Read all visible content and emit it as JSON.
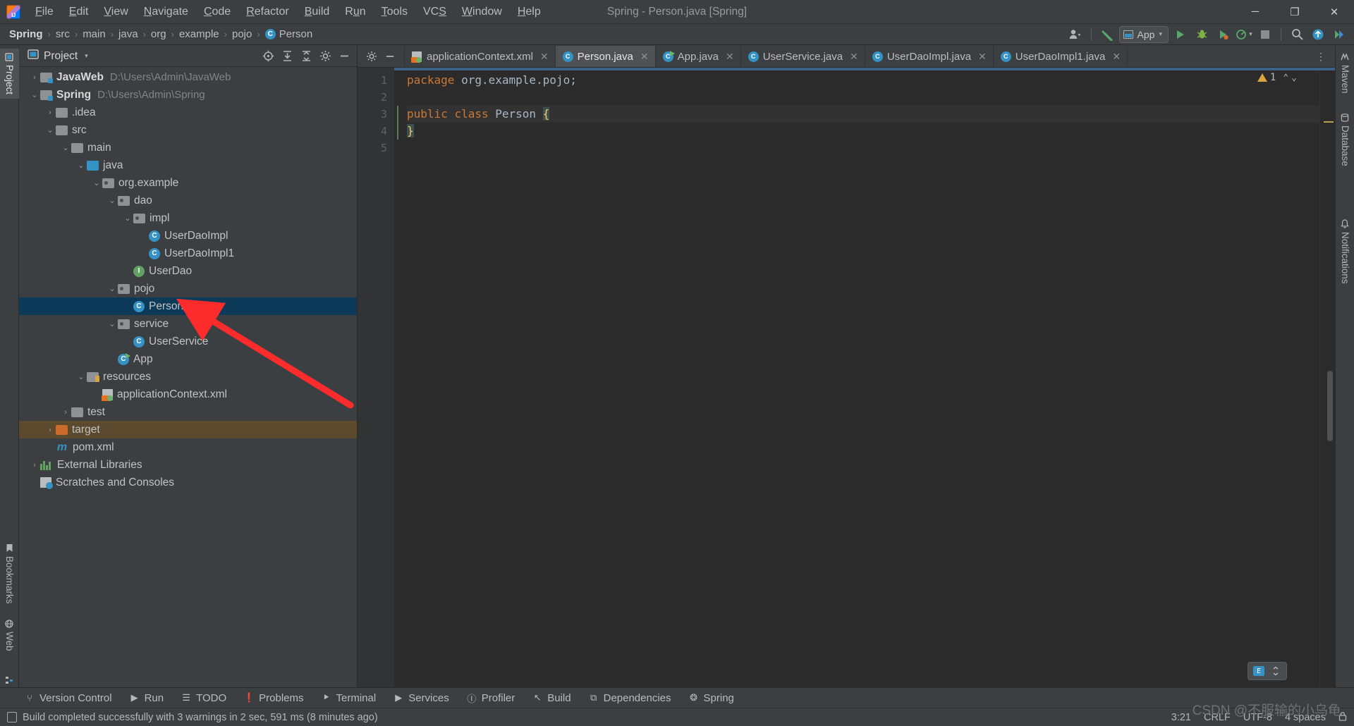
{
  "window": {
    "title": "Spring - Person.java [Spring]",
    "logo": "intellij-idea-logo",
    "controls": [
      {
        "name": "minimize-button",
        "glyph": "─"
      },
      {
        "name": "maximize-button",
        "glyph": "❐"
      },
      {
        "name": "close-button",
        "glyph": "✕"
      }
    ]
  },
  "menubar": {
    "items": [
      {
        "label": "File",
        "mnemonic": "F"
      },
      {
        "label": "Edit",
        "mnemonic": "E"
      },
      {
        "label": "View",
        "mnemonic": "V"
      },
      {
        "label": "Navigate",
        "mnemonic": "N"
      },
      {
        "label": "Code",
        "mnemonic": "C"
      },
      {
        "label": "Refactor",
        "mnemonic": "R"
      },
      {
        "label": "Build",
        "mnemonic": "B"
      },
      {
        "label": "Run",
        "mnemonic": "u"
      },
      {
        "label": "Tools",
        "mnemonic": "T"
      },
      {
        "label": "VCS",
        "mnemonic": "S"
      },
      {
        "label": "Window",
        "mnemonic": "W"
      },
      {
        "label": "Help",
        "mnemonic": "H"
      }
    ]
  },
  "breadcrumb": {
    "items": [
      {
        "label": "Spring",
        "bold": true,
        "icon": null
      },
      {
        "label": "src",
        "bold": false,
        "icon": null
      },
      {
        "label": "main",
        "bold": false,
        "icon": null
      },
      {
        "label": "java",
        "bold": false,
        "icon": null
      },
      {
        "label": "org",
        "bold": false,
        "icon": null
      },
      {
        "label": "example",
        "bold": false,
        "icon": null
      },
      {
        "label": "pojo",
        "bold": false,
        "icon": null
      },
      {
        "label": "Person",
        "bold": false,
        "icon": "class-badge"
      }
    ],
    "separator": "›"
  },
  "toolbar": {
    "account_icon": "account-icon",
    "account_caret": "▾",
    "build_hammer_icon": "build-hammer-icon",
    "run_config": {
      "label": "App",
      "caret": "▾",
      "icon": "run-config-icon"
    },
    "run_icon": "run-button-icon",
    "debug_icon": "debug-button-icon",
    "run_coverage_icon": "run-with-coverage-icon",
    "profiler_icon": "profiler-icon",
    "profiler_caret": "▾",
    "stop_icon": "stop-button-icon",
    "search_icon": "search-everywhere-icon",
    "updates_icon": "updates-icon",
    "settings_icon": "settings-icon"
  },
  "left_strip": {
    "items": [
      {
        "label": "Project",
        "selected": true,
        "icon": "project-icon"
      },
      {
        "label": "Bookmarks",
        "selected": false,
        "icon": "bookmark-icon"
      },
      {
        "label": "Web",
        "selected": false,
        "icon": "web-icon"
      },
      {
        "label": "Structure",
        "selected": false,
        "icon": "structure-icon"
      }
    ]
  },
  "right_strip": {
    "items": [
      {
        "label": "Maven",
        "icon": "maven-icon"
      },
      {
        "label": "Database",
        "icon": "database-icon"
      },
      {
        "label": "Notifications",
        "icon": "notifications-icon"
      }
    ]
  },
  "project_panel": {
    "title": "Project",
    "title_caret": "▾",
    "view_icon": "project-view-icon",
    "header_icons": [
      {
        "name": "select-opened-file-icon",
        "glyph": "⊕"
      },
      {
        "name": "expand-all-icon",
        "glyph": "⨌"
      },
      {
        "name": "collapse-all-icon",
        "glyph": "⨍"
      },
      {
        "name": "settings-gear-icon",
        "glyph": "⚙"
      },
      {
        "name": "hide-panel-icon",
        "glyph": "─"
      }
    ],
    "tree": [
      {
        "label": "JavaWeb",
        "path": "D:\\Users\\Admin\\JavaWeb",
        "depth": 0,
        "arrow": "collapsed",
        "icon": "module-folder",
        "bold": true,
        "state": "normal"
      },
      {
        "label": "Spring",
        "path": "D:\\Users\\Admin\\Spring",
        "depth": 0,
        "arrow": "expanded",
        "icon": "module-folder",
        "bold": true,
        "state": "normal"
      },
      {
        "label": ".idea",
        "path": "",
        "depth": 1,
        "arrow": "collapsed",
        "icon": "folder",
        "bold": false,
        "state": "normal"
      },
      {
        "label": "src",
        "path": "",
        "depth": 1,
        "arrow": "expanded",
        "icon": "folder",
        "bold": false,
        "state": "normal"
      },
      {
        "label": "main",
        "path": "",
        "depth": 2,
        "arrow": "expanded",
        "icon": "folder",
        "bold": false,
        "state": "normal"
      },
      {
        "label": "java",
        "path": "",
        "depth": 3,
        "arrow": "expanded",
        "icon": "source-folder",
        "bold": false,
        "state": "normal"
      },
      {
        "label": "org.example",
        "path": "",
        "depth": 4,
        "arrow": "expanded",
        "icon": "package",
        "bold": false,
        "state": "normal"
      },
      {
        "label": "dao",
        "path": "",
        "depth": 5,
        "arrow": "expanded",
        "icon": "package",
        "bold": false,
        "state": "normal"
      },
      {
        "label": "impl",
        "path": "",
        "depth": 6,
        "arrow": "expanded",
        "icon": "package",
        "bold": false,
        "state": "normal"
      },
      {
        "label": "UserDaoImpl",
        "path": "",
        "depth": 7,
        "arrow": "none",
        "icon": "class",
        "bold": false,
        "state": "normal"
      },
      {
        "label": "UserDaoImpl1",
        "path": "",
        "depth": 7,
        "arrow": "none",
        "icon": "class",
        "bold": false,
        "state": "normal"
      },
      {
        "label": "UserDao",
        "path": "",
        "depth": 6,
        "arrow": "none",
        "icon": "interface",
        "bold": false,
        "state": "normal"
      },
      {
        "label": "pojo",
        "path": "",
        "depth": 5,
        "arrow": "expanded",
        "icon": "package",
        "bold": false,
        "state": "normal"
      },
      {
        "label": "Person",
        "path": "",
        "depth": 6,
        "arrow": "none",
        "icon": "class",
        "bold": false,
        "state": "selected"
      },
      {
        "label": "service",
        "path": "",
        "depth": 5,
        "arrow": "expanded",
        "icon": "package",
        "bold": false,
        "state": "normal"
      },
      {
        "label": "UserService",
        "path": "",
        "depth": 6,
        "arrow": "none",
        "icon": "class",
        "bold": false,
        "state": "normal"
      },
      {
        "label": "App",
        "path": "",
        "depth": 5,
        "arrow": "none",
        "icon": "runnable-class",
        "bold": false,
        "state": "normal"
      },
      {
        "label": "resources",
        "path": "",
        "depth": 3,
        "arrow": "expanded",
        "icon": "resource-folder",
        "bold": false,
        "state": "normal"
      },
      {
        "label": "applicationContext.xml",
        "path": "",
        "depth": 4,
        "arrow": "none",
        "icon": "spring-xml",
        "bold": false,
        "state": "normal"
      },
      {
        "label": "test",
        "path": "",
        "depth": 2,
        "arrow": "collapsed",
        "icon": "folder",
        "bold": false,
        "state": "normal"
      },
      {
        "label": "target",
        "path": "",
        "depth": 1,
        "arrow": "collapsed",
        "icon": "excluded-folder",
        "bold": false,
        "state": "highlighted"
      },
      {
        "label": "pom.xml",
        "path": "",
        "depth": 1,
        "arrow": "none",
        "icon": "maven-pom",
        "bold": false,
        "state": "normal"
      },
      {
        "label": "External Libraries",
        "path": "",
        "depth": 0,
        "arrow": "collapsed",
        "icon": "libraries",
        "bold": false,
        "state": "normal"
      },
      {
        "label": "Scratches and Consoles",
        "path": "",
        "depth": 0,
        "arrow": "none",
        "icon": "scratches",
        "bold": false,
        "state": "normal"
      }
    ]
  },
  "editor": {
    "tab_left_icons": [
      {
        "name": "tab-settings-gear-icon",
        "glyph": "⚙"
      },
      {
        "name": "hide-editor-icon",
        "glyph": "─"
      }
    ],
    "tabs": [
      {
        "label": "applicationContext.xml",
        "icon": "spring-xml",
        "active": false,
        "close": "✕"
      },
      {
        "label": "Person.java",
        "icon": "class",
        "active": true,
        "close": "✕"
      },
      {
        "label": "App.java",
        "icon": "runnable-class",
        "active": false,
        "close": "✕"
      },
      {
        "label": "UserService.java",
        "icon": "class",
        "active": false,
        "close": "✕"
      },
      {
        "label": "UserDaoImpl.java",
        "icon": "class",
        "active": false,
        "close": "✕"
      },
      {
        "label": "UserDaoImpl1.java",
        "icon": "class",
        "active": false,
        "close": "✕"
      }
    ],
    "more_tabs_icon": "⋮",
    "gutter_lines": [
      "1",
      "2",
      "3",
      "4",
      "5"
    ],
    "code_lines": [
      {
        "n": 1,
        "tokens": [
          {
            "t": "package",
            "c": "kw"
          },
          {
            "t": " org.example.pojo;",
            "c": "plain"
          }
        ]
      },
      {
        "n": 2,
        "tokens": []
      },
      {
        "n": 3,
        "tokens": [
          {
            "t": "public",
            "c": "kw"
          },
          {
            "t": " ",
            "c": "plain"
          },
          {
            "t": "class",
            "c": "kw"
          },
          {
            "t": " Person ",
            "c": "plain"
          },
          {
            "t": "{",
            "c": "brace"
          }
        ]
      },
      {
        "n": 4,
        "tokens": [
          {
            "t": "}",
            "c": "brace"
          }
        ]
      },
      {
        "n": 5,
        "tokens": []
      }
    ],
    "inspection": {
      "count": "1",
      "icon": "warning-triangle-icon",
      "chevron_down": "⌄",
      "chevron_up": "⌃"
    }
  },
  "bottom_tools": {
    "items": [
      {
        "label": "Version Control",
        "icon": "version-control-icon",
        "glyph": "⑂"
      },
      {
        "label": "Run",
        "icon": "run-icon",
        "glyph": "▶"
      },
      {
        "label": "TODO",
        "icon": "todo-icon",
        "glyph": "☰"
      },
      {
        "label": "Problems",
        "icon": "problems-icon",
        "glyph": "❗"
      },
      {
        "label": "Terminal",
        "icon": "terminal-icon",
        "glyph": "⯈"
      },
      {
        "label": "Services",
        "icon": "services-icon",
        "glyph": "▶"
      },
      {
        "label": "Profiler",
        "icon": "profiler-icon",
        "glyph": "Ⓘ"
      },
      {
        "label": "Build",
        "icon": "build-hammer-icon",
        "glyph": "↖"
      },
      {
        "label": "Dependencies",
        "icon": "dependencies-icon",
        "glyph": "⧉"
      },
      {
        "label": "Spring",
        "icon": "spring-leaf-icon",
        "glyph": "❂"
      }
    ]
  },
  "statusbar": {
    "message": "Build completed successfully with 3 warnings in 2 sec, 591 ms (8 minutes ago)",
    "message_icon": "build-status-icon",
    "caret_position": "3:21",
    "line_separator": "CRLF",
    "encoding": "UTF-8",
    "indent": "4 spaces",
    "lock_icon": "read-only-lock-icon"
  },
  "watermark": "CSDN @不服输的小乌龟",
  "colors": {
    "accent_blue": "#3592c4",
    "selection_blue": "#0d3a58",
    "keyword_orange": "#cc7832",
    "green_run": "#59a869",
    "warning_yellow": "#d9a441",
    "annotation_red": "#fd2c2c",
    "editor_bg": "#2b2b2b",
    "panel_bg": "#3c3f41"
  }
}
